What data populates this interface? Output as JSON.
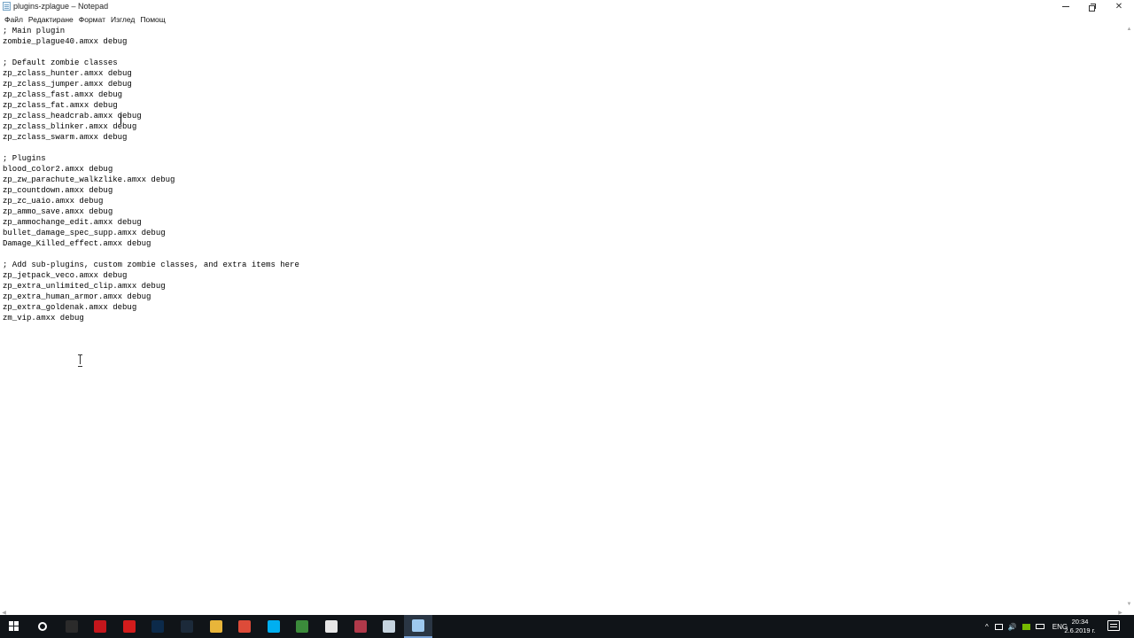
{
  "window": {
    "title": "plugins-zplague – Notepad",
    "icon": "notepad-icon"
  },
  "menu": {
    "items": [
      "Файл",
      "Редактиране",
      "Формат",
      "Изглед",
      "Помощ"
    ]
  },
  "editor": {
    "lines": [
      "; Main plugin",
      "zombie_plague40.amxx debug",
      "",
      "; Default zombie classes",
      "zp_zclass_hunter.amxx debug",
      "zp_zclass_jumper.amxx debug",
      "zp_zclass_fast.amxx debug",
      "zp_zclass_fat.amxx debug",
      "zp_zclass_headcrab.amxx debug",
      "zp_zclass_blinker.amxx debug",
      "zp_zclass_swarm.amxx debug",
      "",
      "; Plugins",
      "blood_color2.amxx debug",
      "zp_zw_parachute_walkzlike.amxx debug",
      "zp_countdown.amxx debug",
      "zp_zc_uaio.amxx debug",
      "zp_ammo_save.amxx debug",
      "zp_ammochange_edit.amxx debug",
      "bullet_damage_spec_supp.amxx debug",
      "Damage_Killed_effect.amxx debug",
      "",
      "; Add sub-plugins, custom zombie classes, and extra items here",
      "zp_jetpack_veco.amxx debug",
      "zp_extra_unlimited_clip.amxx debug",
      "zp_extra_human_armor.amxx debug",
      "zp_extra_goldenak.amxx debug",
      "zm_vip.amxx debug"
    ]
  },
  "taskbar": {
    "apps": [
      {
        "icon": "search-icon",
        "color": "#101418"
      },
      {
        "icon": "terminal-icon",
        "color": "#2b2b2b"
      },
      {
        "icon": "acrobat-icon",
        "color": "#c4161c"
      },
      {
        "icon": "acrobat-reader-icon",
        "color": "#d21c1c"
      },
      {
        "icon": "photoshop-icon",
        "color": "#0c2a4a"
      },
      {
        "icon": "media-player-icon",
        "color": "#1c2a3a"
      },
      {
        "icon": "file-explorer-icon",
        "color": "#e8b53a"
      },
      {
        "icon": "chrome-icon",
        "color": "#dd4b39"
      },
      {
        "icon": "skype-icon",
        "color": "#00aff0"
      },
      {
        "icon": "app-green-icon",
        "color": "#3b8b3b"
      },
      {
        "icon": "counter-strike-icon",
        "color": "#e7e7e7"
      },
      {
        "icon": "mail-app-icon",
        "color": "#b0394a"
      },
      {
        "icon": "steam-icon",
        "color": "#c6d4df"
      },
      {
        "icon": "notepad-icon",
        "color": "#9ec9ef"
      }
    ],
    "language": "ENG",
    "time": "20:34",
    "date": "2.6.2019 г."
  }
}
